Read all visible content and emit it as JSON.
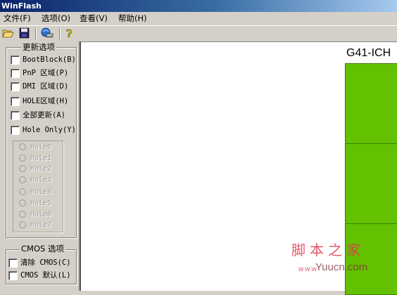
{
  "window": {
    "title": "WinFlash"
  },
  "menu": [
    {
      "label": "文件(F)"
    },
    {
      "label": "选项(O)"
    },
    {
      "label": "查看(V)"
    },
    {
      "label": "帮助(H)"
    }
  ],
  "toolbar": {
    "buttons": [
      {
        "icon": "open-folder-icon"
      },
      {
        "icon": "save-disk-icon"
      },
      {
        "icon": "flash-update-icon"
      },
      {
        "icon": "help-icon"
      }
    ]
  },
  "update_options": {
    "title": "更新选项",
    "items": [
      {
        "label": "BootBlock(B)",
        "checked": false
      },
      {
        "label": "PnP 区域(P)",
        "checked": false
      },
      {
        "label": "DMI 区域(D)",
        "checked": false
      },
      {
        "label": "HOLE区域(H)",
        "checked": false
      },
      {
        "label": "全部更新(A)",
        "checked": false
      },
      {
        "label": "Hole Only(Y)",
        "checked": false
      }
    ],
    "holes": [
      "Hole0",
      "Hole1",
      "Hole2",
      "Hole3",
      "Hole4",
      "Hole5",
      "Hole6",
      "Hole7"
    ]
  },
  "cmos_options": {
    "title": "CMOS 选项",
    "items": [
      {
        "label": "清除 CMOS(C)",
        "checked": false
      },
      {
        "label": "CMOS 默认(L)",
        "checked": false
      }
    ]
  },
  "canvas": {
    "chip_title": "G41-ICH",
    "block_color": "#63c101"
  },
  "watermark": {
    "text": "脚本之家",
    "url": "Yuucn.com",
    "dots": "www"
  }
}
